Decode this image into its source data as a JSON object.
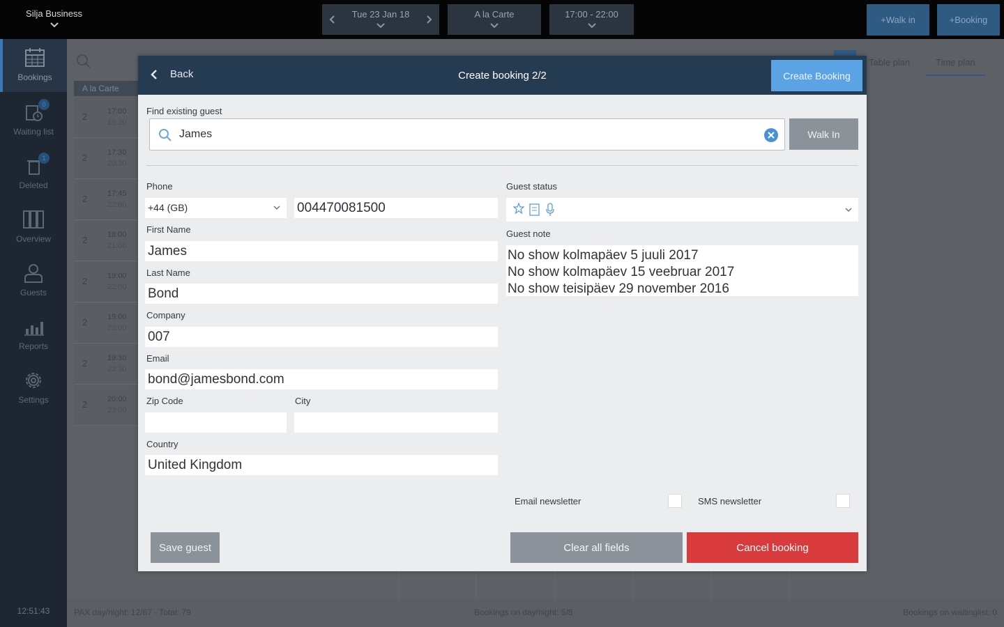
{
  "topbar": {
    "brand": "Silja Business",
    "date": "Tue 23 Jan 18",
    "menu": "A la Carte",
    "time_range": "17:00 - 22:00",
    "walk_in": "+Walk in",
    "booking": "+Booking"
  },
  "sidebar": {
    "items": [
      {
        "label": "Bookings"
      },
      {
        "label": "Waiting list",
        "badge": "0"
      },
      {
        "label": "Deleted",
        "badge": "1"
      },
      {
        "label": "Overview"
      },
      {
        "label": "Guests"
      },
      {
        "label": "Reports"
      },
      {
        "label": "Settings"
      }
    ],
    "clock": "12:51:43"
  },
  "background": {
    "section": "A la Carte",
    "tabs": [
      "Table plan",
      "Time plan"
    ],
    "rows": [
      {
        "pax": "2",
        "start": "17:00",
        "end": "19:30"
      },
      {
        "pax": "2",
        "start": "17:30",
        "end": "20:30"
      },
      {
        "pax": "2",
        "start": "17:45",
        "end": "22:00"
      },
      {
        "pax": "2",
        "start": "18:00",
        "end": "21:00"
      },
      {
        "pax": "2",
        "start": "19:00",
        "end": "22:00"
      },
      {
        "pax": "2",
        "start": "19:00",
        "end": "22:00"
      },
      {
        "pax": "2",
        "start": "19:30",
        "end": "22:30"
      },
      {
        "pax": "2",
        "start": "20:00",
        "end": "23:00"
      }
    ],
    "footer": {
      "pax": "PAX day/night: 12/67 - Total: 79",
      "bookings": "Bookings on day/night: 5/8",
      "waiting": "Bookings on waitinglist: 0"
    }
  },
  "modal": {
    "back": "Back",
    "title": "Create booking 2/2",
    "create_button": "Create Booking",
    "find_label": "Find existing guest",
    "search_value": "James",
    "walk_in_button": "Walk In",
    "phone_label": "Phone",
    "phone_country": "+44 (GB)",
    "phone_number": "004470081500",
    "first_name_label": "First Name",
    "first_name": "James",
    "last_name_label": "Last Name",
    "last_name": "Bond",
    "company_label": "Company",
    "company": "007",
    "email_label": "Email",
    "email": "bond@jamesbond.com",
    "zip_label": "Zip Code",
    "zip": "",
    "city_label": "City",
    "city": "",
    "country_label": "Country",
    "country": "United Kingdom",
    "guest_status_label": "Guest status",
    "guest_note_label": "Guest note",
    "guest_notes": [
      "No show kolmapäev 5 juuli 2017",
      "No show kolmapäev 15 veebruar 2017",
      "No show teisipäev 29 november 2016"
    ],
    "email_newsletter_label": "Email newsletter",
    "sms_newsletter_label": "SMS newsletter",
    "save_guest": "Save guest",
    "clear_fields": "Clear all fields",
    "cancel_booking": "Cancel booking"
  },
  "colors": {
    "header": "#253b52",
    "accent": "#5ca3e6",
    "danger": "#d93a3c",
    "sidebar": "#1d2631"
  }
}
